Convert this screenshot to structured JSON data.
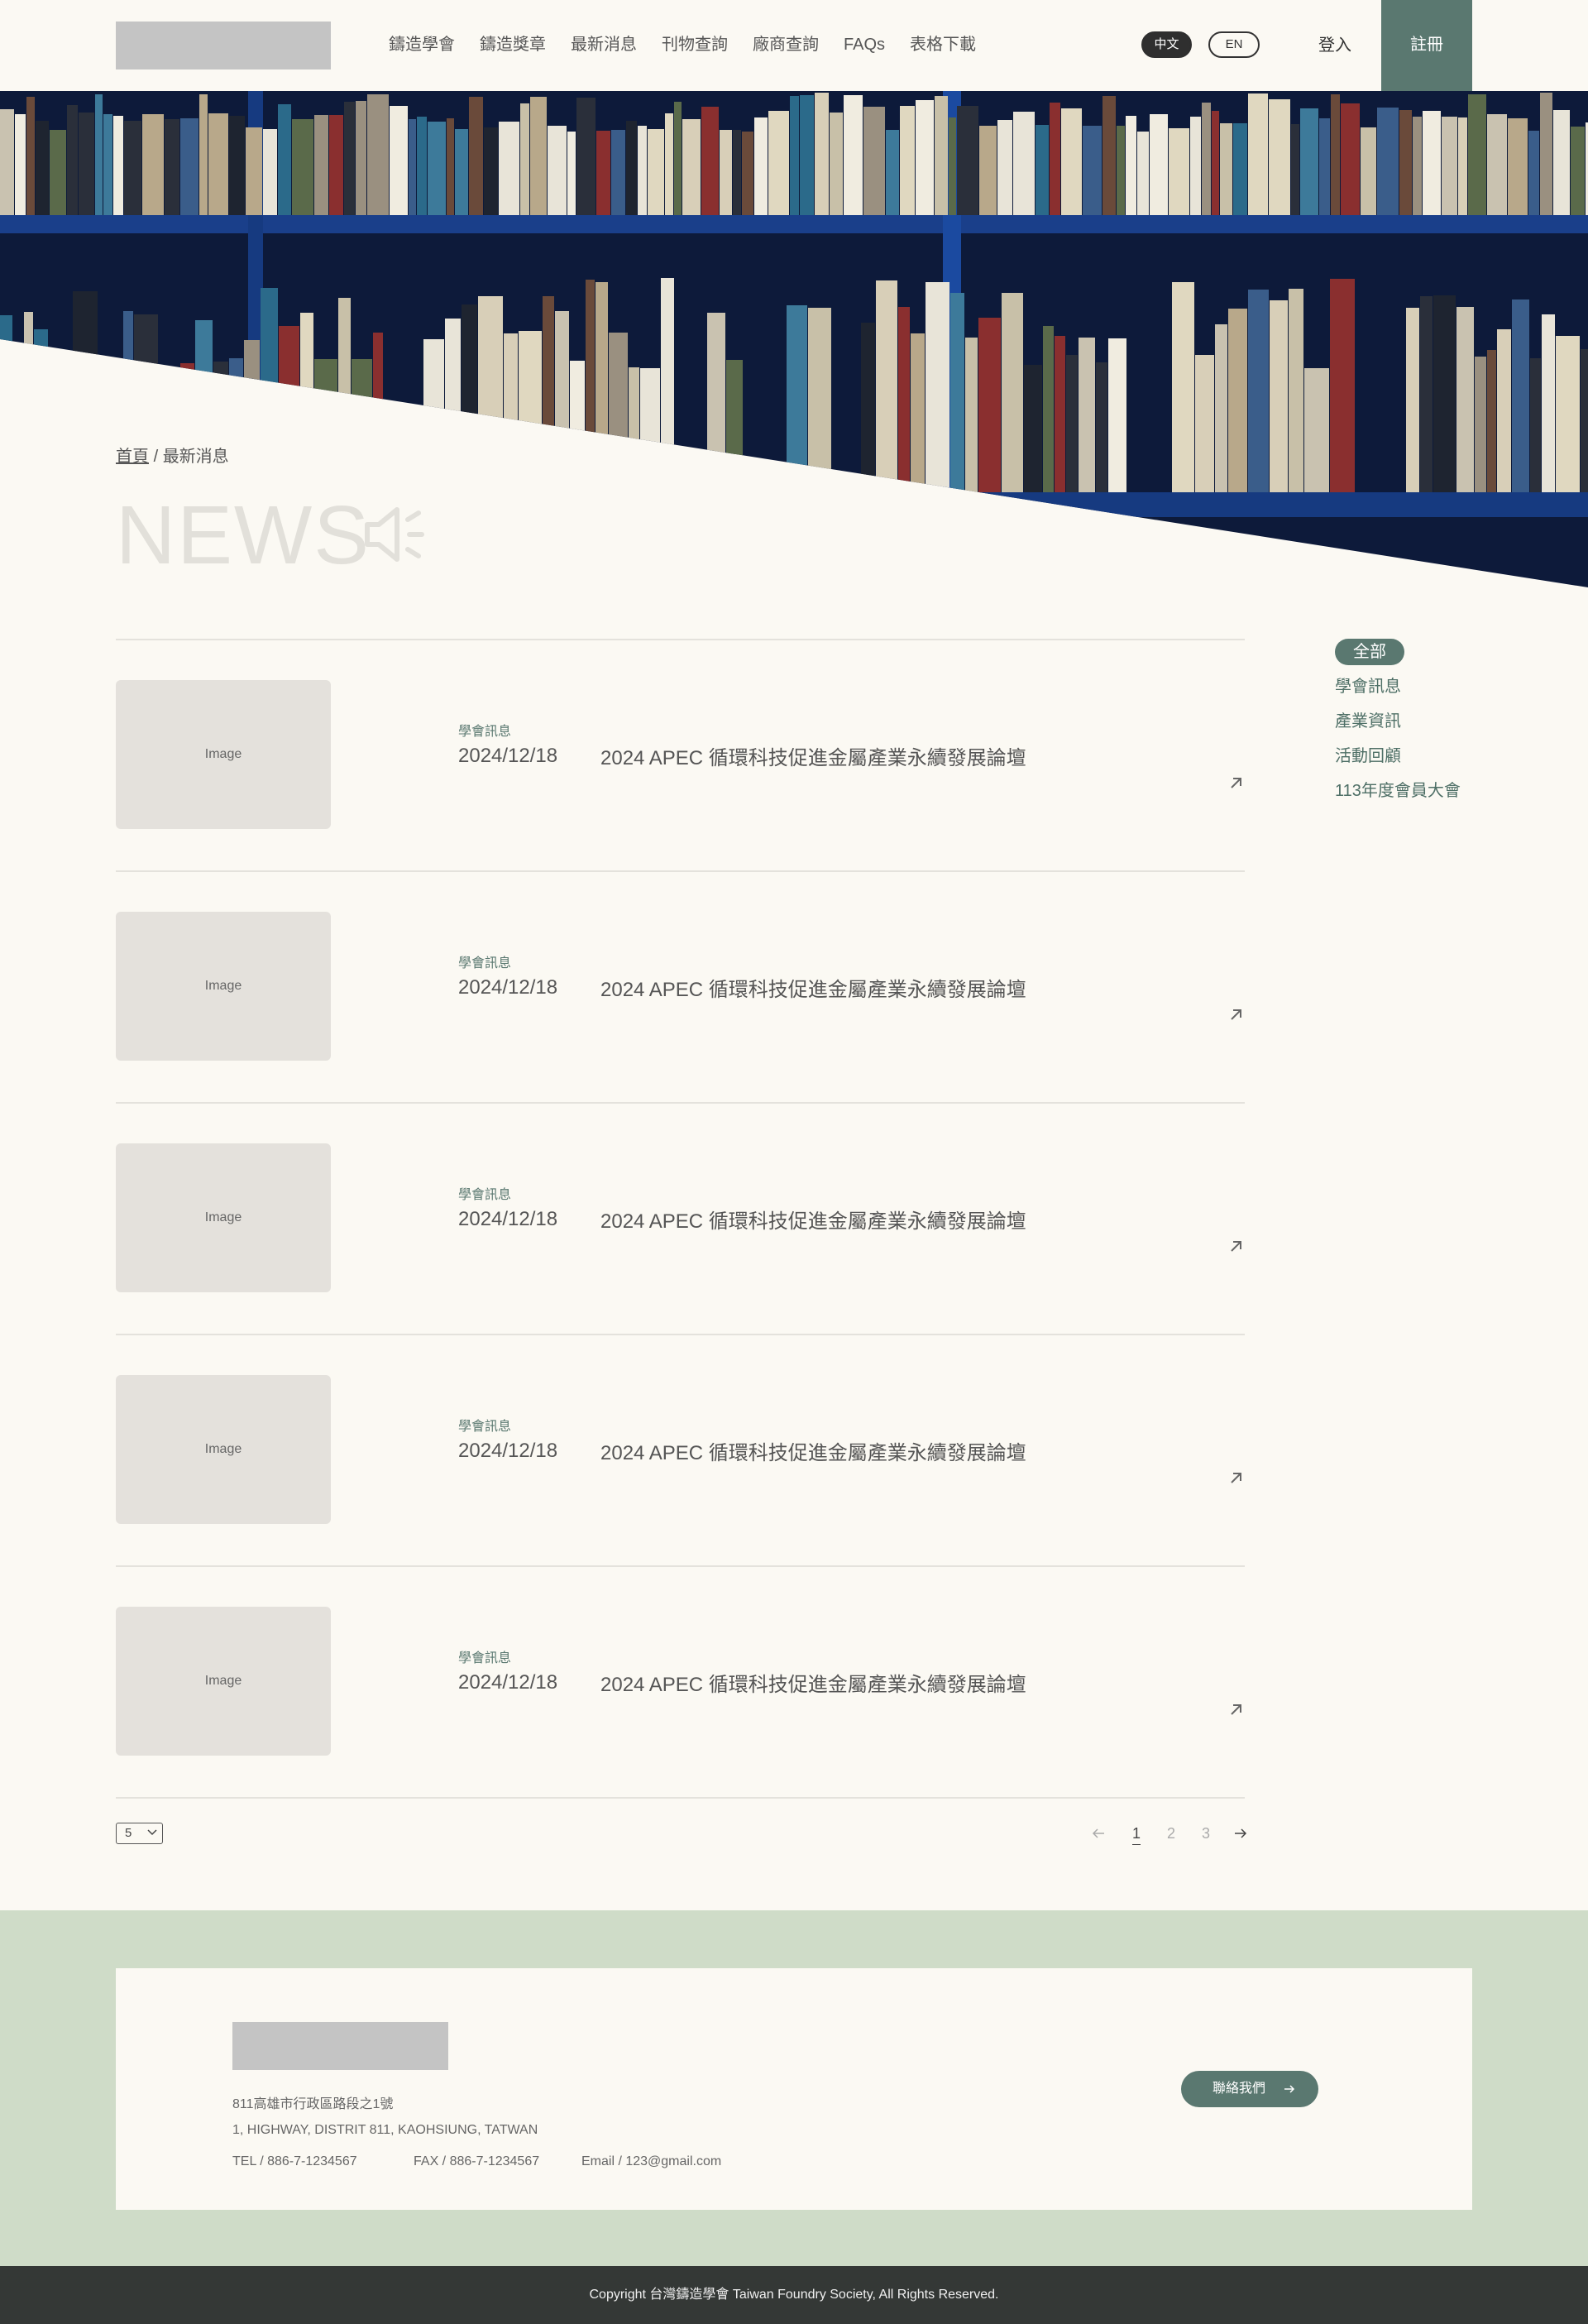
{
  "header": {
    "nav": [
      "鑄造學會",
      "鑄造獎章",
      "最新消息",
      "刊物查詢",
      "廠商查詢",
      "FAQs",
      "表格下載"
    ],
    "lang_zh": "中文",
    "lang_en": "EN",
    "login": "登入",
    "register": "註冊"
  },
  "breadcrumb": {
    "home": "首頁",
    "separator": "/",
    "current": "最新消息"
  },
  "page_title": "NEWS",
  "news": [
    {
      "image": "Image",
      "category": "學會訊息",
      "date": "2024/12/18",
      "title": "2024 APEC 循環科技促進金屬產業永續發展論壇"
    },
    {
      "image": "Image",
      "category": "學會訊息",
      "date": "2024/12/18",
      "title": "2024 APEC 循環科技促進金屬產業永續發展論壇"
    },
    {
      "image": "Image",
      "category": "學會訊息",
      "date": "2024/12/18",
      "title": "2024 APEC 循環科技促進金屬產業永續發展論壇"
    },
    {
      "image": "Image",
      "category": "學會訊息",
      "date": "2024/12/18",
      "title": "2024 APEC 循環科技促進金屬產業永續發展論壇"
    },
    {
      "image": "Image",
      "category": "學會訊息",
      "date": "2024/12/18",
      "title": "2024 APEC 循環科技促進金屬產業永續發展論壇"
    }
  ],
  "categories": [
    "全部",
    "學會訊息",
    "產業資訊",
    "活動回顧",
    "113年度會員大會"
  ],
  "pagination": {
    "page_size": "5",
    "pages": [
      "1",
      "2",
      "3"
    ],
    "current": "1"
  },
  "footer": {
    "address_zh": "811高雄市行政區路段之1號",
    "address_en": "1, HIGHWAY, DISTRIT 811, KAOHSIUNG, TATWAN",
    "tel": "TEL / 886-7-1234567",
    "fax": "FAX / 886-7-1234567",
    "email": "Email / 123@gmail.com",
    "contact": "聯絡我們",
    "copyright": "Copyright 台灣鑄造學會 Taiwan Foundry Society, All Rights Reserved."
  },
  "colors": {
    "accent": "#5a7870",
    "background": "#fbf9f3",
    "footer_band": "#cfdcc8",
    "copyright_bar": "#343836"
  }
}
